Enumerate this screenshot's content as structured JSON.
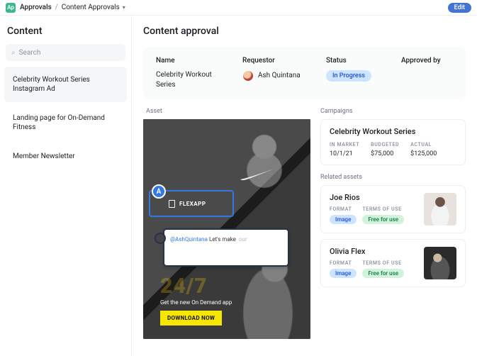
{
  "topbar": {
    "logo_initials": "Ap",
    "crumb_root": "Approvals",
    "crumb_current": "Content Approvals",
    "edit_label": "Edit"
  },
  "sidebar": {
    "title": "Content",
    "search_placeholder": "Search",
    "items": [
      "Celebrity Workout Series Instagram Ad",
      "Landing page for On-Demand Fitness",
      "Member Newsletter"
    ]
  },
  "content": {
    "title": "Content approval",
    "summary": {
      "name_label": "Name",
      "name_value": "Celebrity Workout Series",
      "requestor_label": "Requestor",
      "requestor_name": "Ash Quintana",
      "status_label": "Status",
      "status_value": "In Progress",
      "approved_by_label": "Approved by"
    },
    "asset": {
      "section_label": "Asset",
      "banner_text": "24/7",
      "subline": "Get the new On Demand app",
      "cta": "DOWNLOAD NOW",
      "annotation": {
        "badge_letter": "A",
        "label": "FLEXAPP",
        "comment_mention": "@AshQuintana",
        "comment_body": "Let's make",
        "comment_ghost": "our"
      }
    },
    "campaigns": {
      "section_label": "Campaigns",
      "card": {
        "title": "Celebrity Workout Series",
        "in_market_label": "IN MARKET",
        "in_market_value": "10/1/21",
        "budgeted_label": "BUDGETED",
        "budgeted_value": "$75,000",
        "actual_label": "ACTUAL",
        "actual_value": "$125,000"
      }
    },
    "related": {
      "section_label": "Related assets",
      "format_label": "FORMAT",
      "terms_label": "TERMS OF USE",
      "items": [
        {
          "name": "Joe Rios",
          "format": "Image",
          "terms": "Free for use"
        },
        {
          "name": "Olivia Flex",
          "format": "Image",
          "terms": "Free for use"
        }
      ]
    }
  }
}
